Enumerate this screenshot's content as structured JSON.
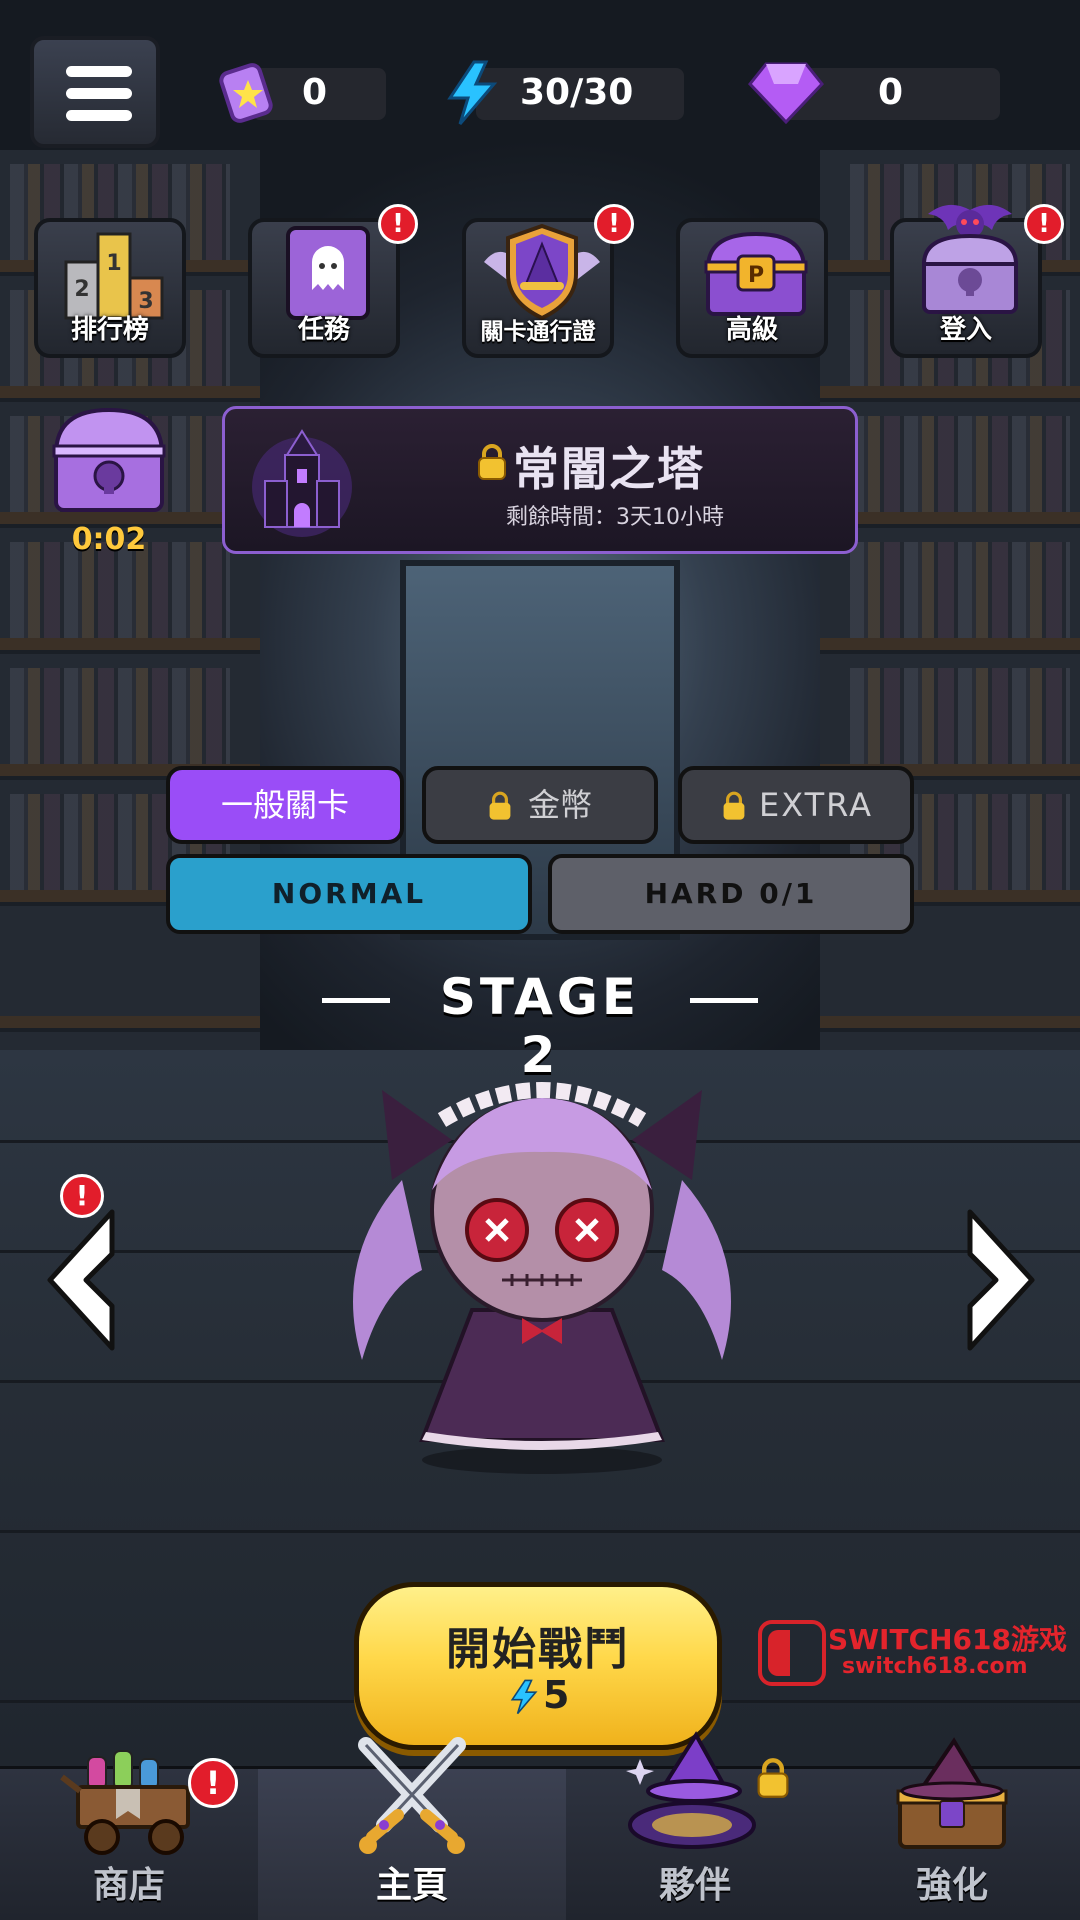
{
  "resources": {
    "tickets": "0",
    "energy": "30/30",
    "gems": "0"
  },
  "features": [
    {
      "label": "排行榜",
      "alert": false
    },
    {
      "label": "任務",
      "alert": true
    },
    {
      "label": "關卡通行證",
      "alert": true
    },
    {
      "label": "高級",
      "alert": false
    },
    {
      "label": "登入",
      "alert": true
    }
  ],
  "alert_mark": "!",
  "chest_timer": "0:02",
  "event": {
    "title": "常闇之塔",
    "remaining": "剩餘時間：3天10小時",
    "locked": true
  },
  "mode_tabs": [
    {
      "label": "一般關卡",
      "active": true,
      "locked": false
    },
    {
      "label": "金幣",
      "active": false,
      "locked": true
    },
    {
      "label": "EXTRA",
      "active": false,
      "locked": true
    }
  ],
  "difficulty": [
    {
      "label": "NORMAL",
      "active": true
    },
    {
      "label": "HARD 0/1",
      "active": false
    }
  ],
  "stage_title": "STAGE 2",
  "start_button": {
    "label": "開始戰鬥",
    "cost": "5"
  },
  "watermark": {
    "line1": "SWITCH618游戏",
    "line2": "switch618.com"
  },
  "nav": [
    {
      "label": "商店",
      "active": false,
      "alert": true,
      "locked": false
    },
    {
      "label": "主頁",
      "active": true,
      "alert": false,
      "locked": false
    },
    {
      "label": "夥伴",
      "active": false,
      "alert": false,
      "locked": true
    },
    {
      "label": "強化",
      "active": false,
      "alert": false,
      "locked": false
    }
  ],
  "colors": {
    "tab_active": "#9a4df7",
    "normal_active": "#2aa0cc",
    "start_button": "#ffd84a",
    "alert": "#e21d2b",
    "timer": "#ffc93c"
  }
}
